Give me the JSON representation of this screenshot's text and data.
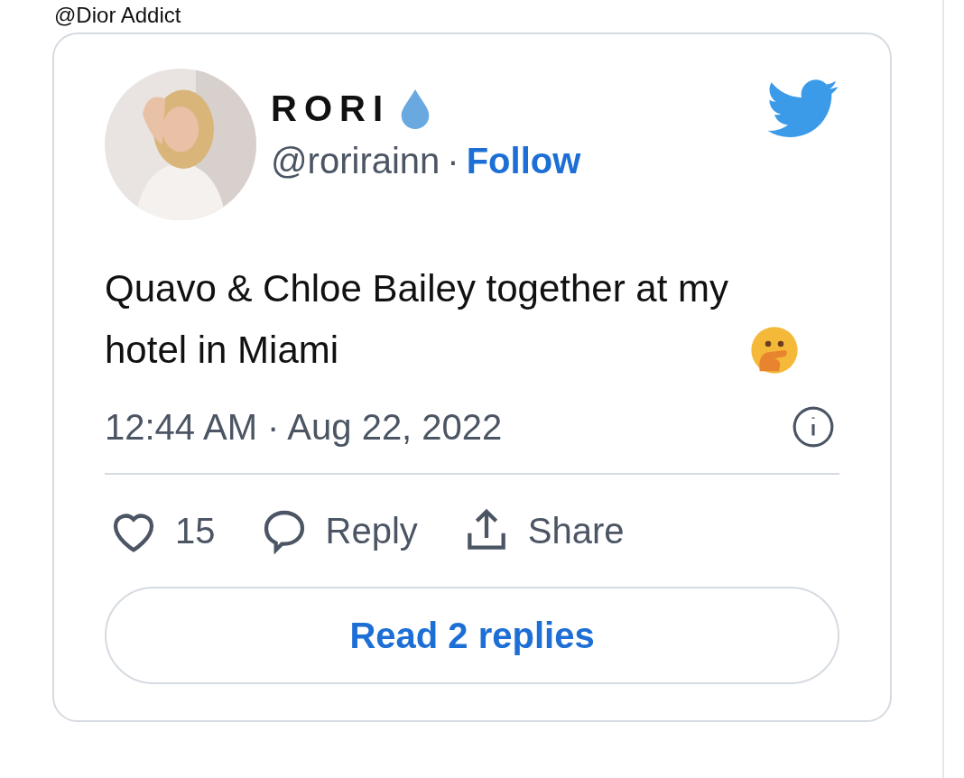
{
  "above_card": {
    "text": "@Dior Addict"
  },
  "tweet": {
    "author": {
      "name": "RORI",
      "handle": "@rorirainn",
      "separator": "·",
      "follow": "Follow"
    },
    "text": "Quavo & Chloe Bailey together at my hotel in Miami",
    "timestamp": "12:44 AM · Aug 22, 2022",
    "actions": [
      {
        "kind": "like",
        "label": "15"
      },
      {
        "kind": "reply",
        "label": "Reply"
      },
      {
        "kind": "share",
        "label": "Share"
      }
    ],
    "read_replies": "Read 2 replies"
  }
}
